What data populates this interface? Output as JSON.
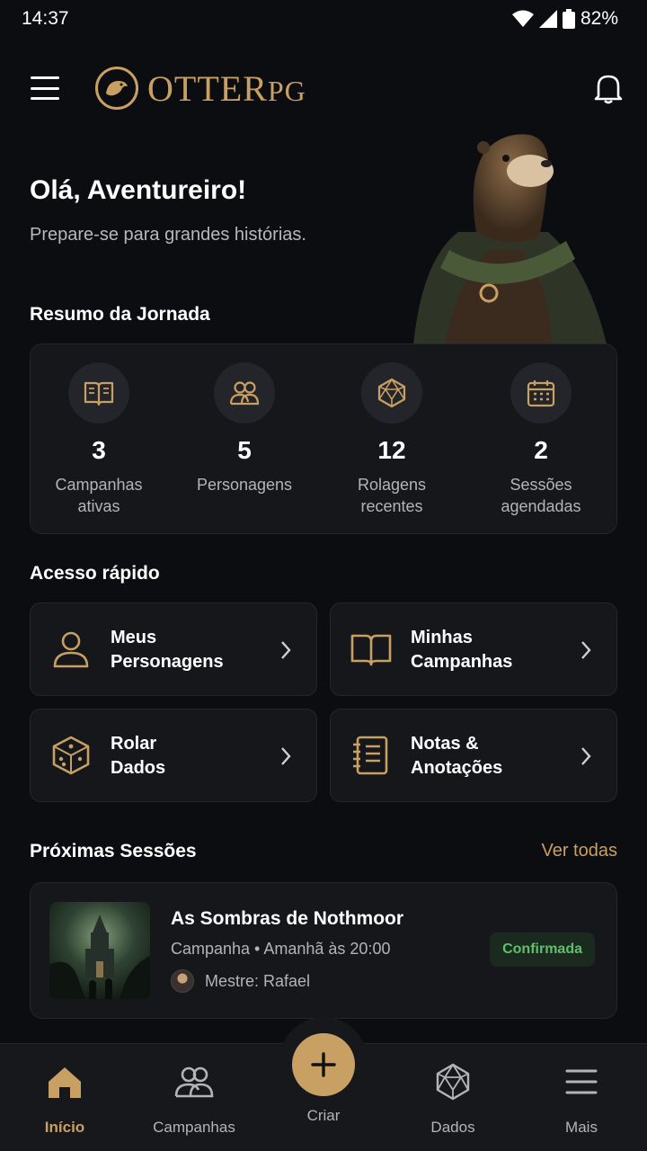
{
  "status_bar": {
    "time": "14:37",
    "battery": "82%"
  },
  "header": {
    "logo_main": "OTTER",
    "logo_suffix": "PG"
  },
  "greeting": {
    "title": "Olá, Aventureiro!",
    "subtitle": "Prepare-se para grandes histórias."
  },
  "summary": {
    "title": "Resumo da Jornada",
    "stats": [
      {
        "value": "3",
        "label_line1": "Campanhas",
        "label_line2": "ativas",
        "icon": "book-icon"
      },
      {
        "value": "5",
        "label_line1": "Personagens",
        "label_line2": "",
        "icon": "users-icon"
      },
      {
        "value": "12",
        "label_line1": "Rolagens",
        "label_line2": "recentes",
        "icon": "d20-icon"
      },
      {
        "value": "2",
        "label_line1": "Sessões",
        "label_line2": "agendadas",
        "icon": "calendar-icon"
      }
    ]
  },
  "quick_access": {
    "title": "Acesso rápido",
    "items": [
      {
        "line1": "Meus",
        "line2": "Personagens",
        "icon": "user-icon"
      },
      {
        "line1": "Minhas",
        "line2": "Campanhas",
        "icon": "book-icon"
      },
      {
        "line1": "Rolar",
        "line2": "Dados",
        "icon": "dice-icon"
      },
      {
        "line1": "Notas &",
        "line2": "Anotações",
        "icon": "notebook-icon"
      }
    ]
  },
  "sessions": {
    "title": "Próximas Sessões",
    "see_all": "Ver todas",
    "items": [
      {
        "title": "As Sombras de Nothmoor",
        "meta": "Campanha • Amanhã às 20:00",
        "master": "Mestre: Rafael",
        "status": "Confirmada"
      }
    ]
  },
  "bottom_nav": {
    "items": [
      {
        "label": "Início",
        "icon": "home-icon",
        "active": true
      },
      {
        "label": "Campanhas",
        "icon": "users-icon"
      },
      {
        "label": "Criar",
        "icon": "plus-icon"
      },
      {
        "label": "Dados",
        "icon": "d20-icon"
      },
      {
        "label": "Mais",
        "icon": "menu-icon"
      }
    ]
  },
  "colors": {
    "accent": "#c9a063",
    "background": "#0c0d10",
    "card": "#15171b",
    "success": "#5fbf6b"
  }
}
